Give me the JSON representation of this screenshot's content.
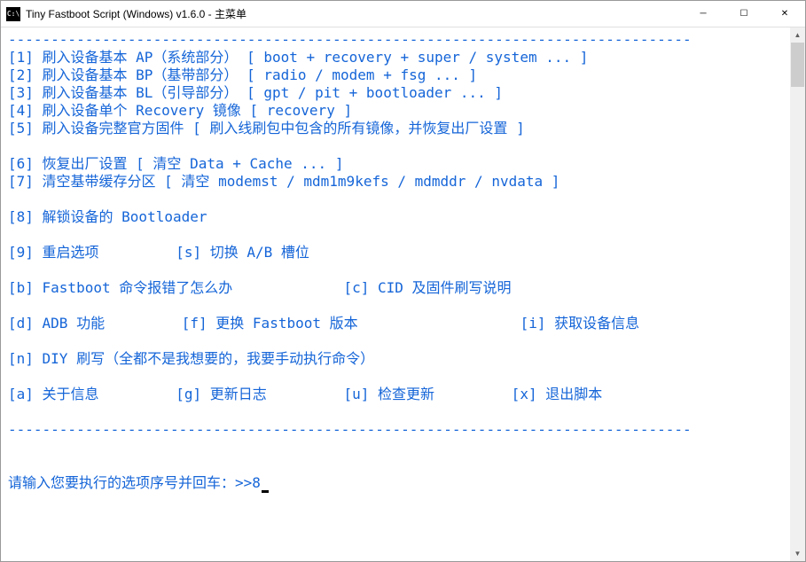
{
  "window": {
    "title": "Tiny Fastboot Script (Windows) v1.6.0 - 主菜单",
    "icon_text": "C:\\",
    "controls": {
      "minimize": "─",
      "maximize": "☐",
      "close": "✕"
    }
  },
  "terminal": {
    "separator_top": "--------------------------------------------------------------------------------",
    "line1": "[1] 刷入设备基本 AP（系统部分） [ boot + recovery + super / system ... ]",
    "line2": "[2] 刷入设备基本 BP（基带部分） [ radio / modem + fsg ... ]",
    "line3": "[3] 刷入设备基本 BL（引导部分） [ gpt / pit + bootloader ... ]",
    "line4": "[4] 刷入设备单个 Recovery 镜像 [ recovery ]",
    "line5": "[5] 刷入设备完整官方固件 [ 刷入线刷包中包含的所有镜像，并恢复出厂设置 ]",
    "line6": "[6] 恢复出厂设置 [ 清空 Data + Cache ... ]",
    "line7": "[7] 清空基带缓存分区 [ 清空 modemst / mdm1m9kefs / mdmddr / nvdata ]",
    "line8": "[8] 解锁设备的 Bootloader",
    "line9": "[9] 重启选项         [s] 切换 A/B 槽位",
    "line_b_c": "[b] Fastboot 命令报错了怎么办             [c] CID 及固件刷写说明",
    "line_d_f_i": "[d] ADB 功能         [f] 更换 Fastboot 版本                   [i] 获取设备信息",
    "line_n": "[n] DIY 刷写（全都不是我想要的，我要手动执行命令）",
    "line_a_g_u_x": "[a] 关于信息         [g] 更新日志         [u] 检查更新         [x] 退出脚本",
    "separator_bottom": "--------------------------------------------------------------------------------",
    "prompt": "请输入您要执行的选项序号并回车：>>",
    "input_value": "8"
  },
  "scrollbar": {
    "up_arrow": "▲",
    "down_arrow": "▼"
  }
}
